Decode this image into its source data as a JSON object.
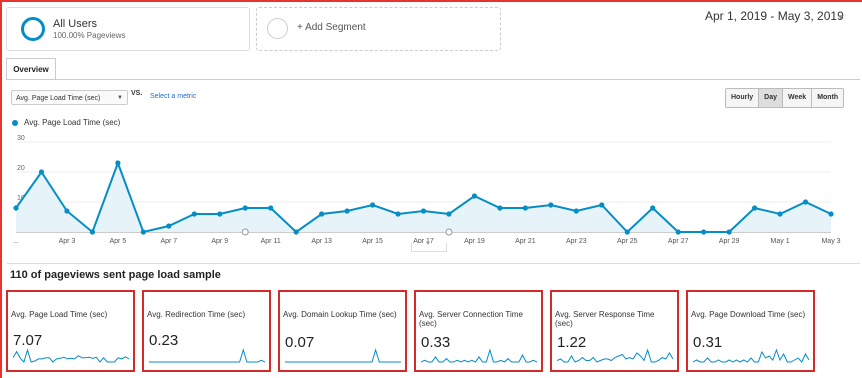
{
  "segment": {
    "name": "All Users",
    "sub": "100.00% Pageviews",
    "add_label": "+ Add Segment"
  },
  "date_range": "Apr 1, 2019 - May 3, 2019",
  "tabs": [
    "Overview"
  ],
  "controls": {
    "metric": "Avg. Page Load Time (sec)",
    "vs": "VS.",
    "select_metric": "Select a metric",
    "granularity": [
      "Hourly",
      "Day",
      "Week",
      "Month"
    ],
    "active_granularity": "Day"
  },
  "chart_data": {
    "type": "area",
    "series": [
      {
        "name": "Avg. Page Load Time (sec)",
        "values": [
          8,
          20,
          7,
          0,
          23,
          0,
          2,
          6,
          6,
          8,
          8,
          0,
          6,
          7,
          9,
          6,
          7,
          6,
          12,
          8,
          8,
          9,
          7,
          9,
          0,
          8,
          0,
          0,
          0,
          8,
          6,
          10,
          6
        ]
      }
    ],
    "x_tick_labels": [
      "...",
      "Apr 3",
      "Apr 5",
      "Apr 7",
      "Apr 9",
      "Apr 11",
      "Apr 13",
      "Apr 15",
      "Apr 17",
      "Apr 19",
      "Apr 21",
      "Apr 23",
      "Apr 25",
      "Apr 27",
      "Apr 29",
      "May 1",
      "May 3"
    ],
    "y_tick_labels": [
      "30",
      "20",
      "10",
      "0"
    ],
    "ylim": [
      0,
      30
    ],
    "color": "#058dc7"
  },
  "section_title": "110 of pageviews sent page load sample",
  "metrics": [
    {
      "title": "Avg. Page Load Time (sec)",
      "value": "7.07"
    },
    {
      "title": "Avg. Redirection Time (sec)",
      "value": "0.23"
    },
    {
      "title": "Avg. Domain Lookup Time (sec)",
      "value": "0.07"
    },
    {
      "title": "Avg. Server Connection Time (sec)",
      "value": "0.33"
    },
    {
      "title": "Avg. Server Response Time (sec)",
      "value": "1.22"
    },
    {
      "title": "Avg. Page Download Time (sec)",
      "value": "0.31"
    }
  ],
  "sparklines": [
    [
      8,
      20,
      7,
      0,
      23,
      0,
      2,
      6,
      6,
      8,
      8,
      0,
      6,
      7,
      9,
      6,
      7,
      6,
      12,
      8,
      8,
      9,
      7,
      9,
      0,
      8,
      0,
      0,
      0,
      8,
      6,
      10,
      6
    ],
    [
      0,
      0,
      0,
      0,
      0,
      0,
      0,
      0,
      0,
      0,
      0,
      0,
      0,
      0,
      0,
      0,
      0,
      0,
      0,
      0,
      0,
      0,
      0,
      0,
      0,
      0,
      7,
      0,
      0,
      0,
      0,
      1,
      0
    ],
    [
      0,
      0,
      0,
      0,
      0,
      0,
      0,
      0,
      0,
      0,
      0,
      0,
      0,
      0,
      0,
      0,
      0,
      0,
      0,
      0,
      0,
      0,
      0,
      0,
      0,
      8,
      0,
      0,
      0,
      0,
      0,
      0,
      0
    ],
    [
      0,
      1,
      0,
      0,
      3,
      0,
      0,
      2,
      0,
      0,
      1,
      0,
      1,
      0,
      1,
      0,
      3,
      0,
      0,
      7,
      0,
      0,
      1,
      0,
      2,
      0,
      0,
      0,
      4,
      0,
      0,
      1,
      0
    ],
    [
      1,
      2,
      0,
      0,
      4,
      0,
      1,
      3,
      1,
      1,
      3,
      0,
      1,
      2,
      2,
      1,
      3,
      4,
      5,
      2,
      3,
      2,
      6,
      4,
      1,
      8,
      0,
      0,
      1,
      3,
      2,
      6,
      2
    ],
    [
      0,
      1,
      0,
      0,
      2,
      0,
      0,
      1,
      0,
      0,
      1,
      0,
      1,
      0,
      1,
      0,
      2,
      0,
      0,
      5,
      2,
      3,
      1,
      6,
      1,
      4,
      0,
      0,
      1,
      2,
      0,
      4,
      1
    ]
  ]
}
